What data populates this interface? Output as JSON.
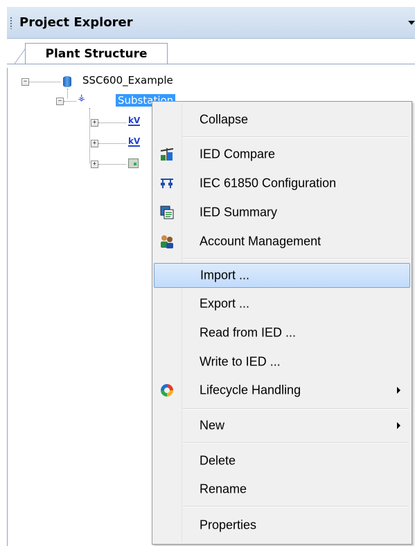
{
  "panel": {
    "title": "Project Explorer",
    "tab_label": "Plant Structure"
  },
  "tree": {
    "root_label": "SSC600_Example",
    "selected_label": "Substation",
    "children": [
      {
        "icon": "voltage-level-icon",
        "icon_text": "kV"
      },
      {
        "icon": "voltage-level-icon",
        "icon_text": "kV"
      },
      {
        "icon": "ied-device-icon",
        "icon_text": ""
      }
    ]
  },
  "context_menu": {
    "items": [
      {
        "label": "Collapse",
        "icon": ""
      },
      {
        "label": "IED Compare",
        "icon": "ied-compare-icon"
      },
      {
        "label": "IEC 61850 Configuration",
        "icon": "iec61850-config-icon"
      },
      {
        "label": "IED Summary",
        "icon": "ied-summary-icon"
      },
      {
        "label": "Account Management",
        "icon": "account-management-icon"
      },
      {
        "label": "Import ...",
        "icon": "",
        "highlighted": true
      },
      {
        "label": "Export ...",
        "icon": ""
      },
      {
        "label": "Read from IED ...",
        "icon": ""
      },
      {
        "label": "Write to IED ...",
        "icon": ""
      },
      {
        "label": "Lifecycle Handling",
        "icon": "lifecycle-icon",
        "submenu": true
      },
      {
        "label": "New",
        "icon": "",
        "submenu": true
      },
      {
        "label": "Delete",
        "icon": ""
      },
      {
        "label": "Rename",
        "icon": ""
      },
      {
        "label": "Properties",
        "icon": ""
      }
    ]
  },
  "colors": {
    "selection": "#3399ff",
    "menu_background": "#f0f0f0",
    "menu_highlight": "#c1dbfc"
  }
}
